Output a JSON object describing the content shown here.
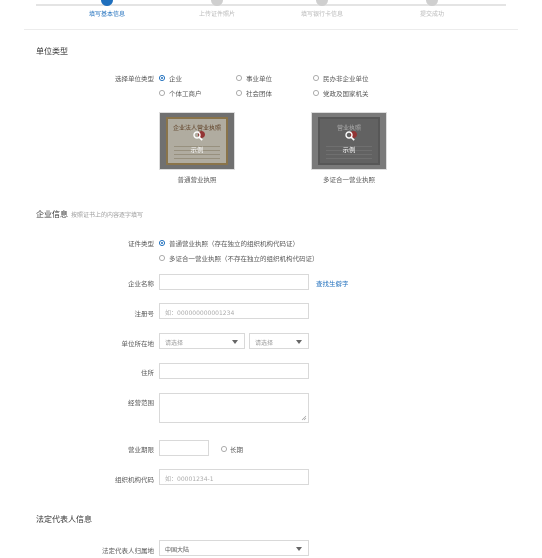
{
  "steps": [
    {
      "label": "填写基本信息",
      "active": true
    },
    {
      "label": "上传证件照片",
      "active": false
    },
    {
      "label": "填写银行卡信息",
      "active": false
    },
    {
      "label": "提交成功",
      "active": false
    }
  ],
  "unit_type": {
    "section_title": "单位类型",
    "select_label": "选择单位类型",
    "options": [
      "企业",
      "事业单位",
      "民办非企业单位",
      "个体工商户",
      "社会团体",
      "党政及国家机关"
    ],
    "selected": "企业",
    "samples": [
      {
        "overlay": "示例",
        "caption": "普通营业执照",
        "cert_title": "企业法人营业执照"
      },
      {
        "overlay": "示例",
        "caption": "多证合一营业执照",
        "cert_title": "营业执照"
      }
    ]
  },
  "company": {
    "section_title": "企业信息",
    "section_hint": "按照证书上的内容逐字填写",
    "license_type_label": "证件类型",
    "license_options": [
      "普通营业执照（存在独立的组织机构代码证）",
      "多证合一营业执照（不存在独立的组织机构代码证）"
    ],
    "name_label": "企业名称",
    "name_value": "",
    "find_link": "查找生僻字",
    "reg_no_label": "注册号",
    "reg_no_placeholder": "如：000000000001234",
    "location_label": "单位所在地",
    "province_placeholder": "请选择",
    "city_placeholder": "请选择",
    "address_label": "住所",
    "scope_label": "经营范围",
    "term_label": "营业期限",
    "long_term_label": "长期",
    "org_code_label": "组织机构代码",
    "org_code_placeholder": "如：00001234-1"
  },
  "legal": {
    "section_title": "法定代表人信息",
    "region_label": "法定代表人归属地",
    "region_value": "中国大陆"
  }
}
